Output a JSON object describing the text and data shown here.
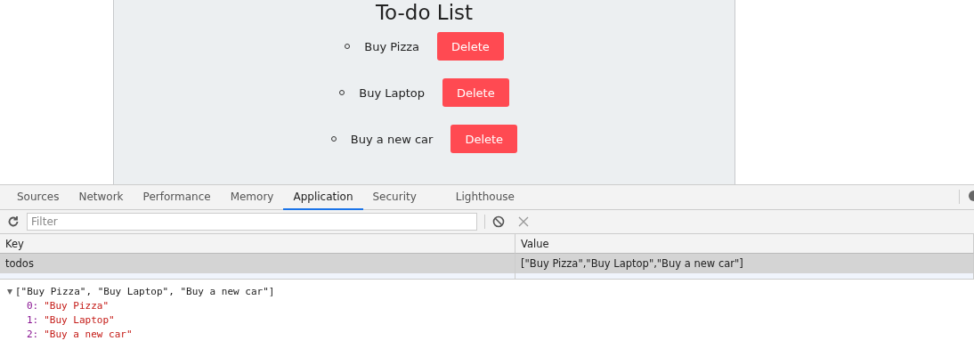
{
  "app": {
    "title": "To-do List",
    "todos": [
      {
        "text": "Buy Pizza",
        "button": "Delete"
      },
      {
        "text": "Buy Laptop",
        "button": "Delete"
      },
      {
        "text": "Buy a new car",
        "button": "Delete"
      }
    ]
  },
  "devtools": {
    "tabs": [
      {
        "label": "Sources",
        "selected": false
      },
      {
        "label": "Network",
        "selected": false
      },
      {
        "label": "Performance",
        "selected": false
      },
      {
        "label": "Memory",
        "selected": false
      },
      {
        "label": "Application",
        "selected": true
      },
      {
        "label": "Security",
        "selected": false
      },
      {
        "label": "Lighthouse",
        "selected": false
      }
    ],
    "filter": {
      "placeholder": "Filter"
    },
    "table": {
      "columns": [
        "Key",
        "Value"
      ],
      "rows": [
        {
          "cells": [
            "todos",
            "[\"Buy Pizza\",\"Buy Laptop\",\"Buy a new car\"]"
          ],
          "selected": true
        }
      ]
    },
    "preview": {
      "summary": "[\"Buy Pizza\", \"Buy Laptop\", \"Buy a new car\"]",
      "expanded": true,
      "children": [
        {
          "key": "0:",
          "value": "\"Buy Pizza\""
        },
        {
          "key": "1:",
          "value": "\"Buy Laptop\""
        },
        {
          "key": "2:",
          "value": "\"Buy a new car\""
        }
      ]
    }
  }
}
